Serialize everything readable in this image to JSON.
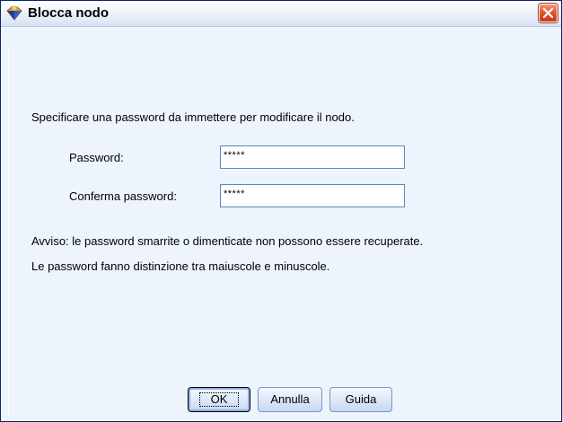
{
  "window": {
    "title": "Blocca nodo",
    "title_icon": "node-lock-icon",
    "close_icon": "close-icon"
  },
  "form": {
    "instruction": "Specificare una password da immettere per modificare il nodo.",
    "password_label": "Password:",
    "password_value": "*****",
    "confirm_label": "Conferma password:",
    "confirm_value": "*****"
  },
  "notes": {
    "warning_line1": "Avviso: le password smarrite o dimenticate non possono essere recuperate.",
    "warning_line2": "Le password fanno distinzione tra maiuscole e minuscole."
  },
  "buttons": {
    "ok": "OK",
    "cancel": "Annulla",
    "help": "Guida"
  },
  "colors": {
    "title_bar": "#dfe9f7",
    "close_button": "#e0552e",
    "dialog_background": "#eef4fc",
    "field_border": "#5a86c4",
    "icon_orange": "#f3a21c",
    "icon_blue": "#1c3f9a"
  }
}
